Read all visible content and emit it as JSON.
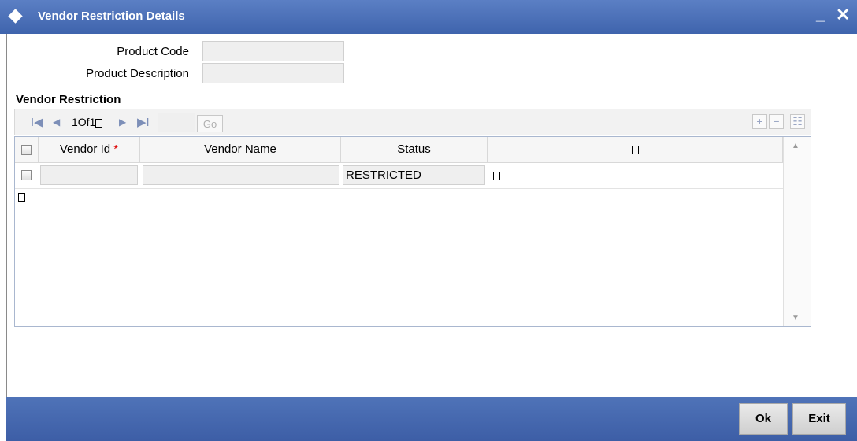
{
  "window": {
    "title": "Vendor Restriction Details",
    "minimize_label": "_",
    "close_label": "✕"
  },
  "form": {
    "product_code_label": "Product Code",
    "product_code_value": "",
    "product_description_label": "Product Description",
    "product_description_value": ""
  },
  "section": {
    "title": "Vendor Restriction"
  },
  "toolbar": {
    "first": "I◀",
    "prev": "◀",
    "pager_text": "1Of1",
    "next": "▶",
    "last": "▶I",
    "goto_value": "",
    "go_label": "Go",
    "add_label": "+",
    "delete_label": "−",
    "columns_label": "☷"
  },
  "table": {
    "columns": [
      "Vendor Id",
      "Vendor Name",
      "Status",
      ""
    ],
    "required_marker": "*",
    "rows": [
      {
        "vendor_id": "",
        "vendor_name": "",
        "status": "RESTRICTED"
      }
    ]
  },
  "footer": {
    "ok_label": "Ok",
    "exit_label": "Exit"
  },
  "colors": {
    "titlebar": "#4a6fb5",
    "footer": "#4466ad",
    "required": "#dd0000"
  },
  "icons": [
    "diamond-icon",
    "first-page-icon",
    "prev-page-icon",
    "next-page-icon",
    "last-page-icon",
    "add-row-icon",
    "delete-row-icon",
    "columns-icon",
    "scroll-up-icon",
    "scroll-down-icon"
  ]
}
